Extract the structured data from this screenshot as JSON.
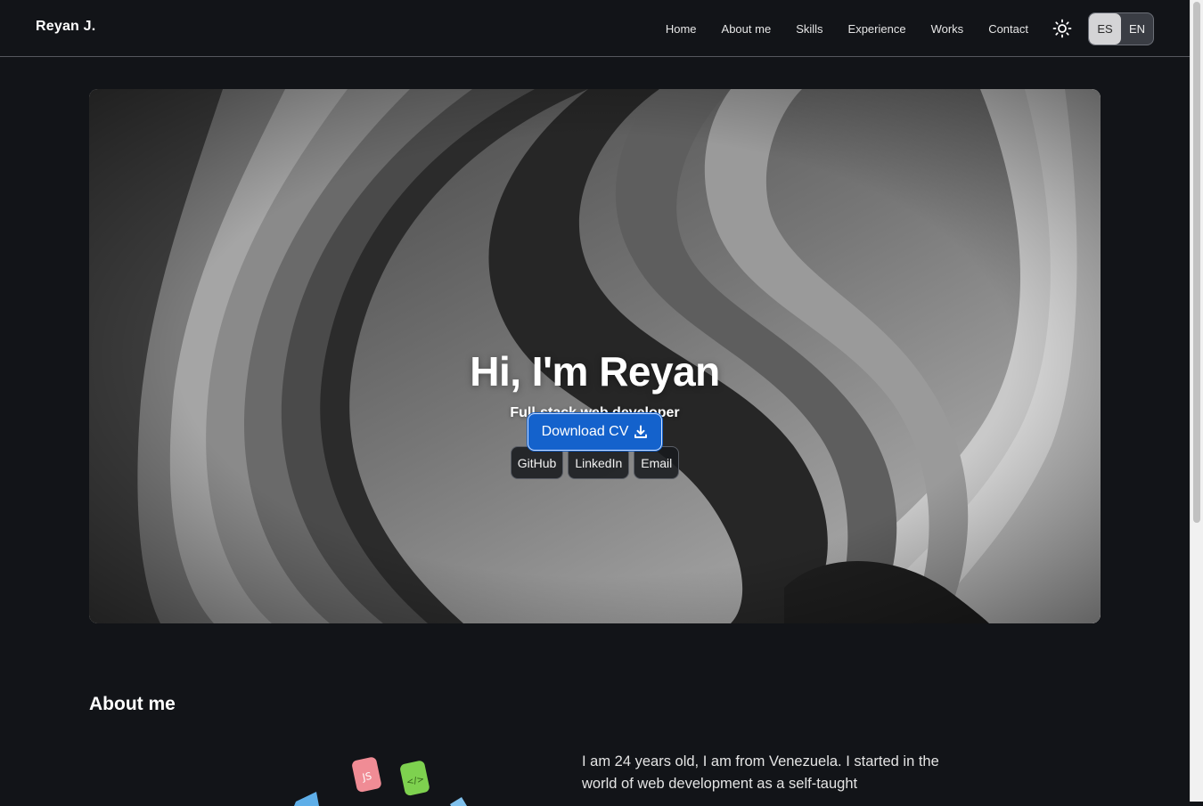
{
  "nav": {
    "brand": "Reyan J.",
    "links": [
      "Home",
      "About me",
      "Skills",
      "Experience",
      "Works",
      "Contact"
    ],
    "theme_icon": "sun-icon",
    "languages": [
      "ES",
      "EN"
    ]
  },
  "hero": {
    "title": "Hi, I'm Reyan",
    "subtitle": "Full-stack web developer",
    "socials": [
      "GitHub",
      "LinkedIn",
      "Email"
    ],
    "cv_label": "Download CV",
    "cv_icon": "download-icon"
  },
  "about": {
    "title": "About me",
    "text": "I am 24 years old, I am from Venezuela. I started in the world of web development as a self-taught",
    "illustration_labels": [
      "JS",
      "</>"
    ]
  },
  "colors": {
    "background": "#121418",
    "accent": "#1462cc",
    "nav_border": "#55585e"
  }
}
